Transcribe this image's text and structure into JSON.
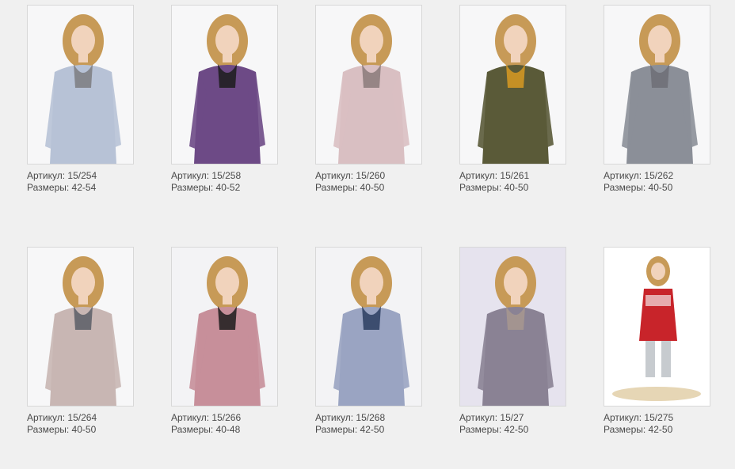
{
  "labels": {
    "article": "Артикул:",
    "sizes": "Размеры:"
  },
  "products": [
    {
      "article": "15/254",
      "sizes": "42-54",
      "photo_bg": "#f7f7f8",
      "garment_color": "#b7c2d6",
      "accent_color": "#7d7d80",
      "icon": "sweater-icon"
    },
    {
      "article": "15/258",
      "sizes": "40-52",
      "photo_bg": "#f7f7f8",
      "garment_color": "#6d4a86",
      "accent_color": "#1c1c1c",
      "icon": "cardigan-icon"
    },
    {
      "article": "15/260",
      "sizes": "40-50",
      "photo_bg": "#f7f7f8",
      "garment_color": "#d9bfc2",
      "accent_color": "#8a7a7a",
      "icon": "cowl-sweater-icon"
    },
    {
      "article": "15/261",
      "sizes": "40-50",
      "photo_bg": "#f7f7f8",
      "garment_color": "#5a5a38",
      "accent_color": "#d89a22",
      "icon": "poncho-icon"
    },
    {
      "article": "15/262",
      "sizes": "40-50",
      "photo_bg": "#f7f7f8",
      "garment_color": "#8b8f98",
      "accent_color": "#6d6f75",
      "icon": "tunic-icon"
    },
    {
      "article": "15/264",
      "sizes": "40-50",
      "photo_bg": "#f7f7f8",
      "garment_color": "#c8b6b3",
      "accent_color": "#5b5e66",
      "icon": "bow-sweater-icon"
    },
    {
      "article": "15/266",
      "sizes": "40-48",
      "photo_bg": "#f3f3f5",
      "garment_color": "#c78f9a",
      "accent_color": "#1c1c1c",
      "icon": "plaid-shirt-icon"
    },
    {
      "article": "15/268",
      "sizes": "42-50",
      "photo_bg": "#f3f3f5",
      "garment_color": "#9aa4c2",
      "accent_color": "#2c3e60",
      "icon": "plaid-shirt-icon"
    },
    {
      "article": "15/27",
      "sizes": "42-50",
      "photo_bg": "#e6e3ee",
      "garment_color": "#8a8294",
      "accent_color": "#a7988f",
      "icon": "back-view-dress-icon"
    },
    {
      "article": "15/275",
      "sizes": "42-50",
      "photo_bg": "#ffffff",
      "garment_color": "#c8242a",
      "accent_color": "#c7cbcf",
      "icon": "tunic-dress-icon"
    }
  ]
}
